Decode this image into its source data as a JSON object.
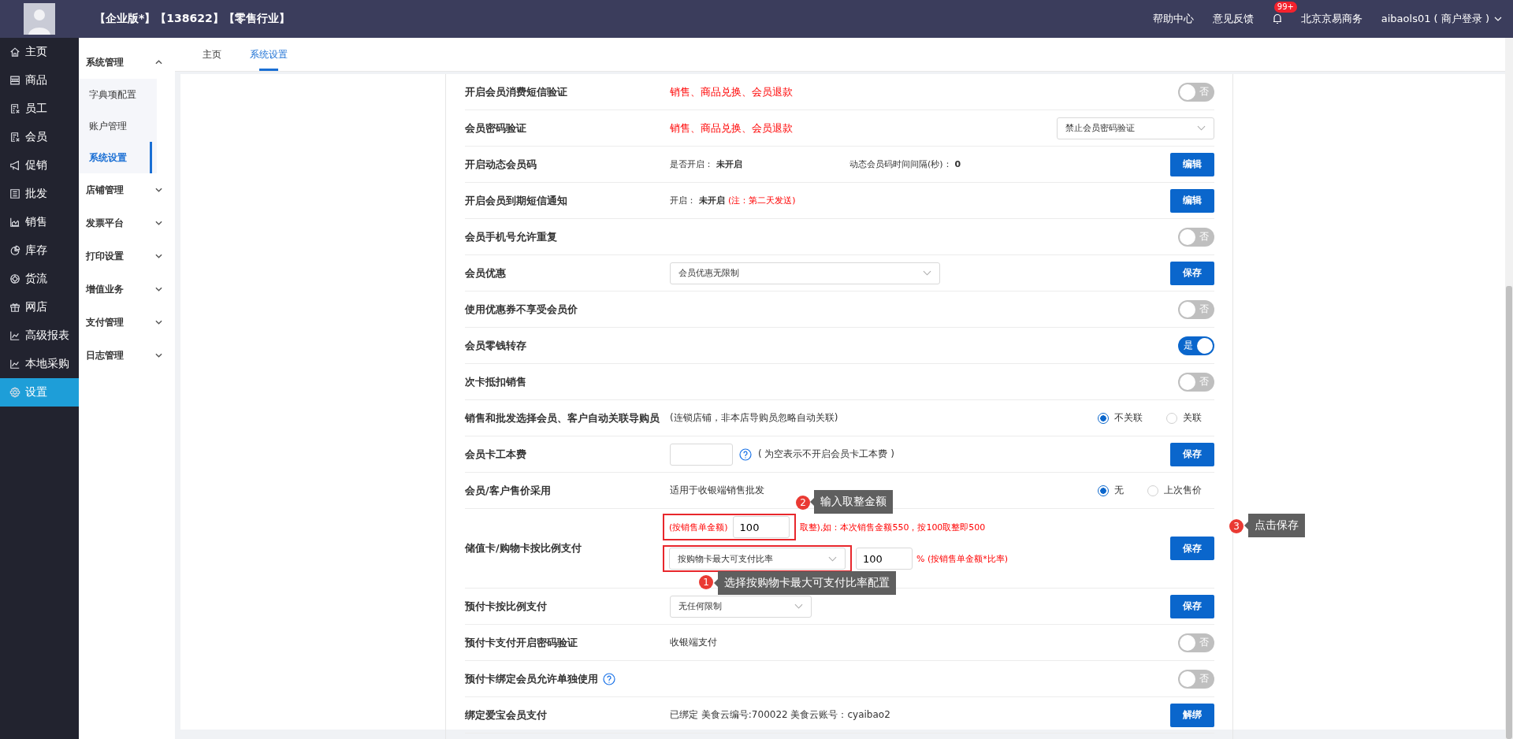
{
  "topbar": {
    "title": "【企业版*】【138622】【零售行业】",
    "links": [
      "帮助中心",
      "意见反馈"
    ],
    "notification_badge": "99+",
    "company": "北京京易商务",
    "user": "aibaols01 ( 商户登录 )"
  },
  "nav": [
    {
      "label": "主页",
      "selected": false
    },
    {
      "label": "商品",
      "selected": false
    },
    {
      "label": "员工",
      "selected": false
    },
    {
      "label": "会员",
      "selected": false
    },
    {
      "label": "促销",
      "selected": false
    },
    {
      "label": "批发",
      "selected": false
    },
    {
      "label": "销售",
      "selected": false
    },
    {
      "label": "库存",
      "selected": false
    },
    {
      "label": "货流",
      "selected": false
    },
    {
      "label": "网店",
      "selected": false
    },
    {
      "label": "高级报表",
      "selected": false
    },
    {
      "label": "本地采购",
      "selected": false
    },
    {
      "label": "设置",
      "selected": true
    }
  ],
  "menu": [
    {
      "label": "系统管理",
      "expanded": true,
      "children": [
        {
          "label": "字典项配置",
          "selected": false
        },
        {
          "label": "账户管理",
          "selected": false
        },
        {
          "label": "系统设置",
          "selected": true
        }
      ]
    },
    {
      "label": "店铺管理",
      "expanded": false
    },
    {
      "label": "发票平台",
      "expanded": false
    },
    {
      "label": "打印设置",
      "expanded": false
    },
    {
      "label": "增值业务",
      "expanded": false
    },
    {
      "label": "支付管理",
      "expanded": false
    },
    {
      "label": "日志管理",
      "expanded": false
    }
  ],
  "tabs": [
    {
      "label": "主页",
      "selected": false
    },
    {
      "label": "系统设置",
      "selected": true
    }
  ],
  "settings": [
    {
      "kind": "toggle",
      "label": "开启会员消费短信验证",
      "note": "销售、商品兑换、会员退款",
      "alert": true,
      "on": false,
      "toggle_text": "否"
    },
    {
      "kind": "select",
      "label": "会员密码验证",
      "note": "销售、商品兑换、会员退款",
      "alert": true,
      "select": "禁止会员密码验证"
    },
    {
      "kind": "edit",
      "label": "开启动态会员码",
      "info": [
        {
          "label": "是否开启：",
          "value": "未开启"
        },
        {
          "label": "动态会员码时间间隔(秒)：",
          "value": "0"
        }
      ],
      "button": "编辑"
    },
    {
      "kind": "edit",
      "label": "开启会员到期短信通知",
      "info": [
        {
          "label": "开启：",
          "value": "未开启",
          "remark": "(注：第二天发送)"
        }
      ],
      "button": "编辑"
    },
    {
      "kind": "toggle",
      "label": "会员手机号允许重复",
      "on": false,
      "toggle_text": "否"
    },
    {
      "kind": "select_save",
      "label": "会员优惠",
      "select": "会员优惠无限制",
      "wide": true,
      "button": "保存"
    },
    {
      "kind": "toggle",
      "label": "使用优惠券不享受会员价",
      "on": false,
      "toggle_text": "否"
    },
    {
      "kind": "toggle",
      "label": "会员零钱转存",
      "on": true,
      "toggle_text": "是"
    },
    {
      "kind": "toggle",
      "label": "次卡抵扣销售",
      "on": false,
      "toggle_text": "否"
    },
    {
      "kind": "radio",
      "label": "销售和批发选择会员、客户自动关联导购员",
      "note": "(连锁店铺，非本店导购员忽略自动关联)",
      "alert": false,
      "options": [
        {
          "label": "不关联",
          "selected": true
        },
        {
          "label": "关联",
          "selected": false
        }
      ]
    },
    {
      "kind": "fee",
      "label": "会员卡工本费",
      "note": "( 为空表示不开启会员卡工本费 )",
      "alert": false,
      "button": "保存"
    },
    {
      "kind": "radio",
      "label": "会员/客户售价采用",
      "note": "适用于收银端销售批发",
      "alert": false,
      "options": [
        {
          "label": "无",
          "selected": true
        },
        {
          "label": "上次售价",
          "selected": false
        }
      ]
    },
    {
      "kind": "ratio",
      "label": "储值卡/购物卡按比例支付",
      "amount": {
        "prefix": "(按销售单金额)",
        "value": "100",
        "suffix": "取整),如：本次销售金额550，按100取整即500",
        "highlighted": true
      },
      "mode": {
        "select": "按购物卡最大可支付比率",
        "value": "100",
        "suffix": "% (按销售单金额*比率)",
        "highlighted": true
      },
      "button": "保存",
      "callouts": [
        {
          "step": "2",
          "text": "输入取整金额"
        },
        {
          "step": "1",
          "text": "选择按购物卡最大可支付比率配置"
        },
        {
          "step": "3",
          "text": "点击保存"
        }
      ]
    },
    {
      "kind": "select_save",
      "label": "预付卡按比例支付",
      "select": "无任何限制",
      "wide": false,
      "button": "保存"
    },
    {
      "kind": "toggle",
      "label": "预付卡支付开启密码验证",
      "note": "收银端支付",
      "alert": false,
      "on": false,
      "toggle_text": "否"
    },
    {
      "kind": "toggle",
      "label": "预付卡绑定会员允许单独使用",
      "label_help": true,
      "on": false,
      "toggle_text": "否"
    },
    {
      "kind": "edit",
      "label": "绑定爱宝会员支付",
      "note": "已绑定 美食云编号:700022 美食云账号：cyaibao2",
      "alert": false,
      "button": "解绑"
    }
  ]
}
